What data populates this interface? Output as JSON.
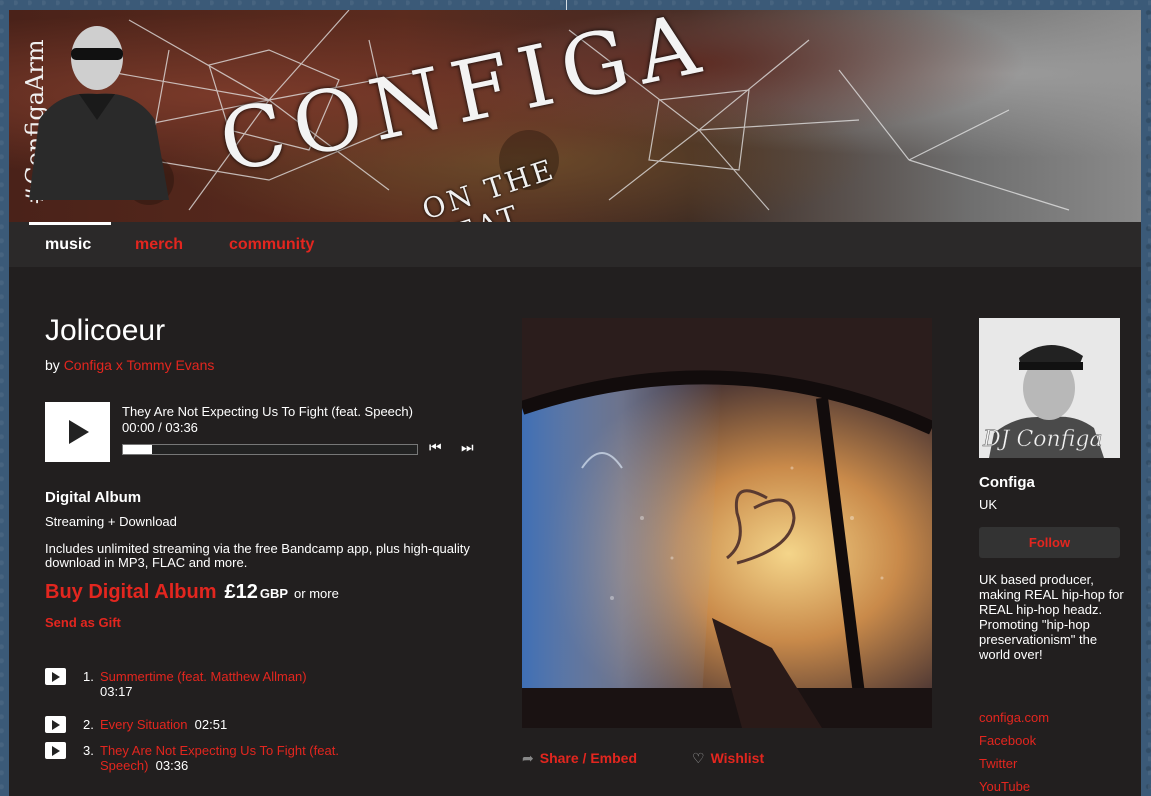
{
  "banner": {
    "side_tag": "#ConfigaArmy",
    "logo_main": "CONFIGA",
    "logo_sub": "ON THE BEAT"
  },
  "nav": {
    "tabs": [
      {
        "label": "music"
      },
      {
        "label": "merch"
      },
      {
        "label": "community"
      }
    ]
  },
  "album": {
    "title": "Jolicoeur",
    "by_prefix": "by",
    "artist_credit": "Configa x Tommy Evans"
  },
  "player": {
    "track_title": "They Are Not Expecting Us To Fight (feat. Speech)",
    "time": "00:00 / 03:36",
    "progress_fraction": 0.1,
    "prev_glyph": "⏮",
    "next_glyph": "⏭"
  },
  "purchase": {
    "heading": "Digital Album",
    "subheading": "Streaming + Download",
    "description": "Includes unlimited streaming via the free Bandcamp app, plus high-quality download in MP3, FLAC and more.",
    "buy_label": "Buy Digital Album",
    "price": "£12",
    "currency": "GBP",
    "or_more": "or more",
    "gift_label": "Send as Gift"
  },
  "tracks": [
    {
      "num": "1.",
      "name": "Summertime (feat. Matthew Allman)",
      "duration": "03:17"
    },
    {
      "num": "2.",
      "name": "Every Situation",
      "duration": "02:51"
    },
    {
      "num": "3.",
      "name": "They Are Not Expecting Us To Fight (feat. Speech)",
      "duration": "03:36"
    }
  ],
  "actions": {
    "share_label": "Share / Embed",
    "wishlist_label": "Wishlist",
    "share_icon": "share-icon",
    "wishlist_icon": "heart-icon"
  },
  "artist": {
    "name": "Configa",
    "location": "UK",
    "follow_label": "Follow",
    "bio": "UK based producer, making REAL hip-hop for REAL hip-hop headz. Promoting \"hip-hop preservationism\" the world over!",
    "photo_caption": "DJ Configa",
    "links": [
      "configa.com",
      "Facebook",
      "Twitter",
      "YouTube"
    ]
  },
  "colors": {
    "accent": "#e3261f",
    "background": "#221f1f",
    "nav": "#2b2929"
  }
}
